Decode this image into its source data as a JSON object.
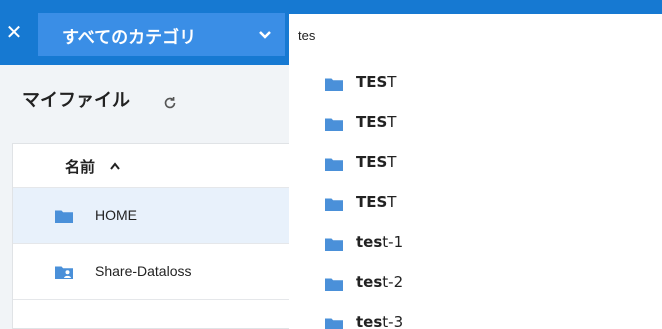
{
  "topbar": {
    "close_icon": "close-icon",
    "category_label": "すべてのカテゴリ",
    "search_value": "tes"
  },
  "left": {
    "title": "マイファイル",
    "column_name": "名前",
    "rows": [
      {
        "label": "HOME",
        "icon": "folder-icon",
        "selected": true
      },
      {
        "label": "Share-Dataloss",
        "icon": "shared-folder-icon",
        "selected": false
      }
    ]
  },
  "results": [
    {
      "match": "TES",
      "rest": "T"
    },
    {
      "match": "TES",
      "rest": "T"
    },
    {
      "match": "TES",
      "rest": "T"
    },
    {
      "match": "TES",
      "rest": "T"
    },
    {
      "match": "tes",
      "rest": "t-1"
    },
    {
      "match": "tes",
      "rest": "t-2"
    },
    {
      "match": "tes",
      "rest": "t-3"
    }
  ],
  "colors": {
    "topbar": "#1679d2",
    "category_button": "#3a8ee6",
    "folder": "#4a90d9"
  }
}
